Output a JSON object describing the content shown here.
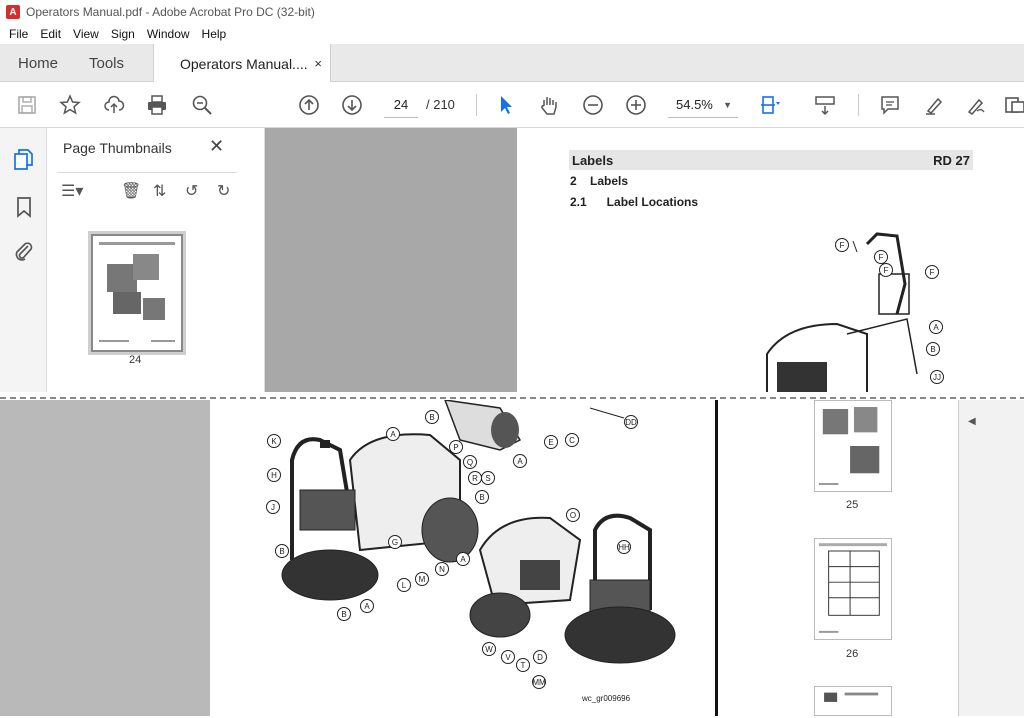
{
  "app": {
    "title": "Operators Manual.pdf - Adobe Acrobat Pro DC (32-bit)",
    "icon": "acrobat-icon"
  },
  "menu": [
    "File",
    "Edit",
    "View",
    "Sign",
    "Window",
    "Help"
  ],
  "tabs": {
    "home": "Home",
    "tools": "Tools",
    "doc": "Operators Manual....",
    "close": "×"
  },
  "toolbar": {
    "page_current": "24",
    "page_total": "/ 210",
    "zoom": "54.5%"
  },
  "thumbnails_panel": {
    "title": "Page Thumbnails",
    "close": "✕",
    "pages": [
      "24",
      "25",
      "26"
    ]
  },
  "document": {
    "header_left": "Labels",
    "header_right": "RD 27",
    "section2": "2    Labels",
    "section21": "2.1      Label Locations",
    "figure_caption": "wc_gr009696",
    "callouts_top": [
      "F",
      "F",
      "F",
      "F",
      "A",
      "B",
      "JJ"
    ],
    "callouts_lower": [
      "K",
      "A",
      "P",
      "Q",
      "R",
      "S",
      "B",
      "H",
      "J",
      "B",
      "G",
      "L",
      "M",
      "N",
      "A",
      "B",
      "A",
      "O",
      "HH",
      "W",
      "V",
      "T",
      "D",
      "MM",
      "B",
      "E",
      "C",
      "DD",
      "A"
    ]
  },
  "colors": {
    "acrobat_red": "#d32f2f",
    "doc_background": "#a8a8a8",
    "cursor_blue": "#1473e6"
  }
}
